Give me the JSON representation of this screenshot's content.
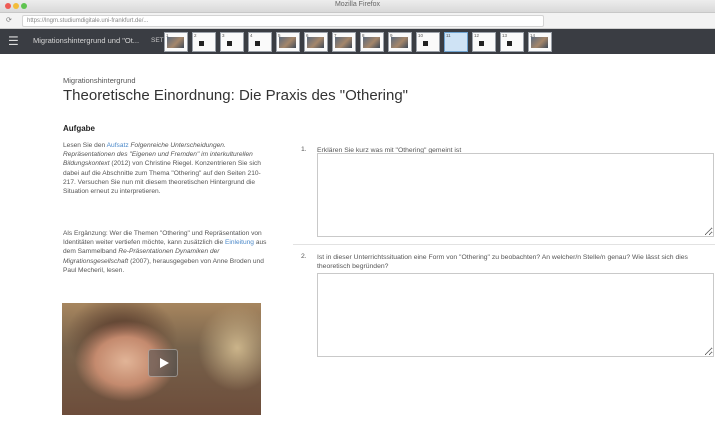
{
  "browser": {
    "window_title": "Mozilla Firefox",
    "url": "https://lngm.studiumdigitale.uni-frankfurt.de/..."
  },
  "appbar": {
    "breadcrumb": "Migrationshintergrund und \"Ot...",
    "set_label": "SET 1",
    "thumbnails": [
      {
        "num": "1",
        "kind": "picture"
      },
      {
        "num": "2",
        "kind": "text"
      },
      {
        "num": "3",
        "kind": "text"
      },
      {
        "num": "4",
        "kind": "text"
      },
      {
        "num": "5",
        "kind": "picture"
      },
      {
        "num": "6",
        "kind": "picture"
      },
      {
        "num": "7",
        "kind": "picture"
      },
      {
        "num": "8",
        "kind": "picture"
      },
      {
        "num": "9",
        "kind": "picture"
      },
      {
        "num": "10",
        "kind": "text"
      },
      {
        "num": "11",
        "kind": "active"
      },
      {
        "num": "12",
        "kind": "text"
      },
      {
        "num": "13",
        "kind": "text"
      },
      {
        "num": "14",
        "kind": "picture"
      }
    ]
  },
  "content": {
    "eyebrow": "Migrationshintergrund",
    "title": "Theoretische Einordnung: Die Praxis des \"Othering\"",
    "task_heading": "Aufgabe",
    "p1_pre": "Lesen Sie den ",
    "p1_link": "Aufsatz",
    "p1_italic": " Folgenreiche Unterscheidungen. Repräsentationen des \"Eigenen und Fremden\" im interkulturellen Bildungskontext",
    "p1_post": " (2012) von Christine Riegel. Konzentrieren Sie sich dabei auf die Abschnitte zum Thema \"Othering\" auf den Seiten 210-217. Versuchen Sie nun mit diesem theoretischen Hintergrund die Situation erneut zu interpretieren.",
    "p2_pre": "Als Ergänzung: Wer die Themen \"Othering\" und Repräsentation von Identitäten weiter vertiefen möchte, kann zusätzlich die ",
    "p2_link": "Einleitung",
    "p2_mid": " aus dem Sammelband ",
    "p2_italic": "Re-Präsentationen Dynamiken der Migrationsgesellschaft",
    "p2_post": " (2007), herausgegeben von Anne Broden und Paul Mecheril, lesen."
  },
  "questions": [
    {
      "num": "1.",
      "text": "Erklären Sie kurz was mit \"Othering\" gemeint ist",
      "answer": ""
    },
    {
      "num": "2.",
      "text": "Ist in dieser Unterrichtssituation eine Form von \"Othering\" zu beobachten? An welcher/n Stelle/n genau? Wie lässt sich dies theoretisch begründen?",
      "answer": ""
    }
  ],
  "icons": {
    "menu": "hamburger-icon",
    "video_play": "play-icon"
  }
}
